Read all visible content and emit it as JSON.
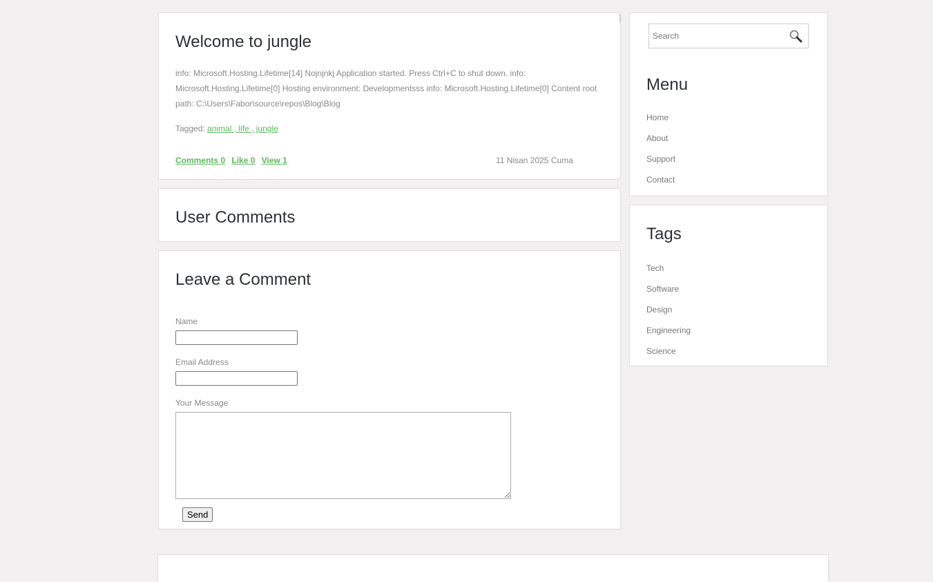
{
  "post": {
    "title": "Welcome to jungle",
    "body": "info: Microsoft.Hosting.Lifetime[14] Nojnjnkj Application started. Press Ctrl+C to shut down. info: Microsoft.Hosting.Lifetime[0] Hosting environment: Developmentsss info: Microsoft.Hosting.Lifetime[0] Content root path: C:\\Users\\Fabor\\source\\repos\\Blog\\Blog",
    "tagged_label": "Tagged:",
    "tags_link": "animal , life , jungle",
    "comments_link": "Comments 0",
    "like_link": "Like 0",
    "view_link": "View 1",
    "date": "11 Nisan 2025 Cuma"
  },
  "comments_section": {
    "title": "User Comments"
  },
  "leave_comment": {
    "title": "Leave a Comment",
    "name_label": "Name",
    "name_value": "",
    "email_label": "Email Address",
    "email_value": "",
    "message_label": "Your Message",
    "message_value": "",
    "send_label": "Send"
  },
  "sidebar": {
    "search": {
      "placeholder": "Search",
      "icon": "search-icon"
    },
    "menu_title": "Menu",
    "menu_items": [
      "Home",
      "About",
      "Support",
      "Contact"
    ],
    "tags_title": "Tags",
    "tag_items": [
      "Tech",
      "Software",
      "Design",
      "Engineering",
      "Science"
    ]
  },
  "colors": {
    "background": "#f2f0f0",
    "panel": "#ffffff",
    "link": "#5cb85c",
    "heading": "#2d3136",
    "muted_text": "#888888"
  }
}
